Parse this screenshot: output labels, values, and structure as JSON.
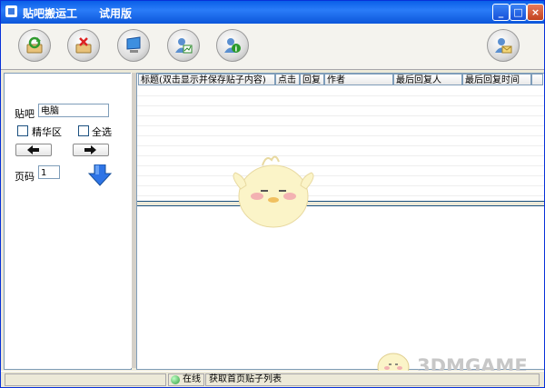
{
  "window": {
    "title": "贴吧搬运工　　试用版",
    "controls": {
      "minimize": "_",
      "maximize": "□",
      "close": "×"
    }
  },
  "toolbar": {
    "buttons": [
      {
        "name": "refresh-button",
        "icon": "refresh-icon"
      },
      {
        "name": "delete-button",
        "icon": "delete-icon"
      },
      {
        "name": "monitor-button",
        "icon": "monitor-icon"
      },
      {
        "name": "user-chart-button",
        "icon": "user-chart-icon"
      },
      {
        "name": "user-info-button",
        "icon": "user-info-icon"
      },
      {
        "name": "user-mail-button",
        "icon": "user-mail-icon"
      }
    ]
  },
  "left": {
    "bar_label": "贴吧",
    "bar_value": "电脑",
    "featured_label": "精华区",
    "select_all_label": "全选",
    "page_label": "页码",
    "page_value": "1"
  },
  "grid": {
    "columns": [
      "标题(双击显示并保存贴子内容)",
      "点击",
      "回复",
      "作者",
      "最后回复人",
      "最后回复时间"
    ]
  },
  "status": {
    "online": "在线",
    "message": "获取首页贴子列表"
  },
  "watermark": {
    "text": "3DMGAME"
  },
  "colors": {
    "titlebar": "#0A5FE8",
    "panel_border": "#7F9DB9",
    "status_green": "#2c9b3a",
    "arrow_blue": "#2E74E6"
  }
}
